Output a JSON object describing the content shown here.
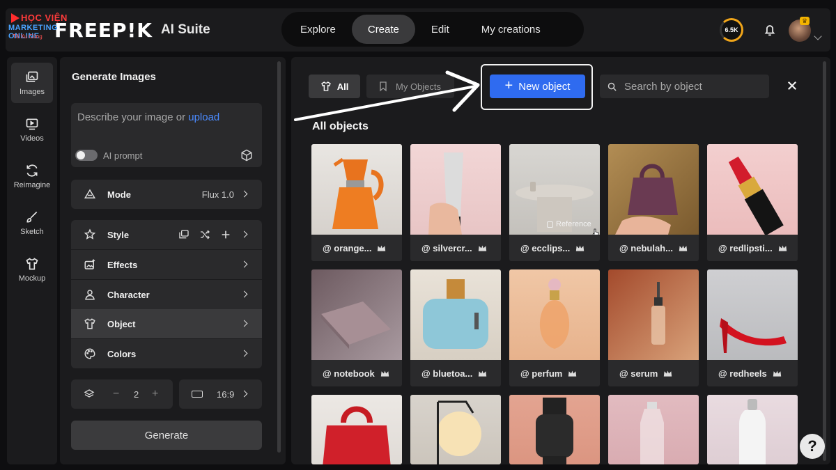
{
  "watermark": {
    "top": "HỌC VIỆN",
    "mid": "MARKETING ONLINE",
    "bot": "Tố Xu Cùng"
  },
  "brand": {
    "wordmark": "FREEP!K",
    "suite": "AI Suite"
  },
  "nav": {
    "items": [
      "Explore",
      "Create",
      "Edit",
      "My creations"
    ],
    "active": "Create"
  },
  "header": {
    "credits": "6.5K"
  },
  "rail": {
    "items": [
      {
        "label": "Images",
        "icon": "image-icon"
      },
      {
        "label": "Videos",
        "icon": "video-icon"
      },
      {
        "label": "Reimagine",
        "icon": "refresh-icon"
      },
      {
        "label": "Sketch",
        "icon": "brush-icon"
      },
      {
        "label": "Mockup",
        "icon": "shirt-icon"
      }
    ],
    "active": "Images"
  },
  "panel": {
    "title": "Generate Images",
    "prompt_placeholder": "Describe your image or ",
    "prompt_link": "upload",
    "ai_prompt_label": "AI prompt",
    "mode": {
      "label": "Mode",
      "value": "Flux 1.0"
    },
    "style": {
      "label": "Style"
    },
    "effects": {
      "label": "Effects"
    },
    "character": {
      "label": "Character"
    },
    "object": {
      "label": "Object"
    },
    "colors": {
      "label": "Colors"
    },
    "count": {
      "minus": "−",
      "value": "2",
      "plus": "+"
    },
    "ratio": {
      "value": "16:9"
    },
    "generate_label": "Generate"
  },
  "objects": {
    "tab_all": "All",
    "tab_mine": "My Objects",
    "new_object": "New object",
    "new_object_plus": "+",
    "search_placeholder": "Search by object",
    "section_title": "All objects",
    "reference_tag": "Reference",
    "items": [
      "@ orange...",
      "@ silvercr...",
      "@ ecclips...",
      "@ nebulah...",
      "@ redlipsti...",
      "@ notebook",
      "@ bluetoa...",
      "@ perfum",
      "@ serum",
      "@ redheels"
    ]
  },
  "help_label": "?",
  "colors": {
    "accent": "#2f6bf0",
    "panel": "#1b1b1d",
    "card": "#2a2a2c",
    "credit_ring": "#f0a51a"
  }
}
